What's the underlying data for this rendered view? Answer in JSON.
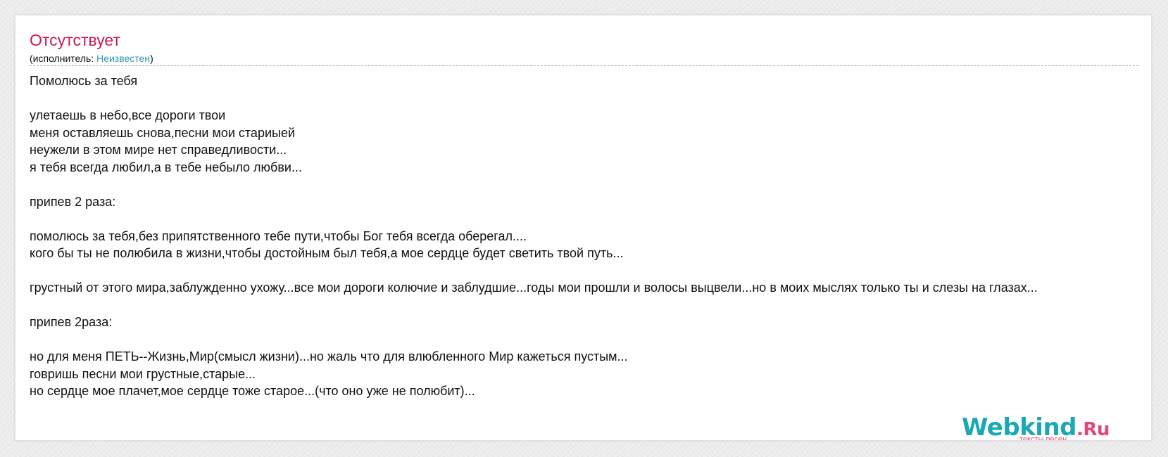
{
  "song": {
    "title": "Отсутствует",
    "performer_prefix": "(исполнитель: ",
    "performer_name": "Неизвестен",
    "performer_suffix": ")"
  },
  "lyrics": [
    "Помолюсь за тебя",
    "",
    "улетаешь в небо,все дороги твои",
    "меня оставляешь снова,песни мои стариыей",
    "неужели в этом мире нет справедливости...",
    "я тебя всегда любил,а в тебе небыло любви...",
    "",
    "припев 2 раза:",
    "",
    "помолюсь за тебя,без припятственного тебе пути,чтобы Бог тебя всегда оберегал....",
    "кого бы ты не полюбила в жизни,чтобы достойным был тебя,а мое сердце будет светить твой путь...",
    "",
    "грустный от этого мира,заблужденно ухожу...все мои дороги колючие и заблудшие...годы мои прошли и волосы выцвели...но в моих мыслях только ты и слезы на глазах...",
    "",
    "припев 2раза:",
    "",
    "но для меня ПЕТЬ--Жизнь,Мир(смысл жизни)...но жаль что для влюбленного Мир кажеться пустым...",
    "говришь песни мои грустные,старые...",
    "но сердце мое плачет,мое сердце тоже старое...(что оно уже не полюбит)..."
  ],
  "logo": {
    "name": "Webkind",
    "tld": ".Ru",
    "subtitle": "тексты песен"
  }
}
